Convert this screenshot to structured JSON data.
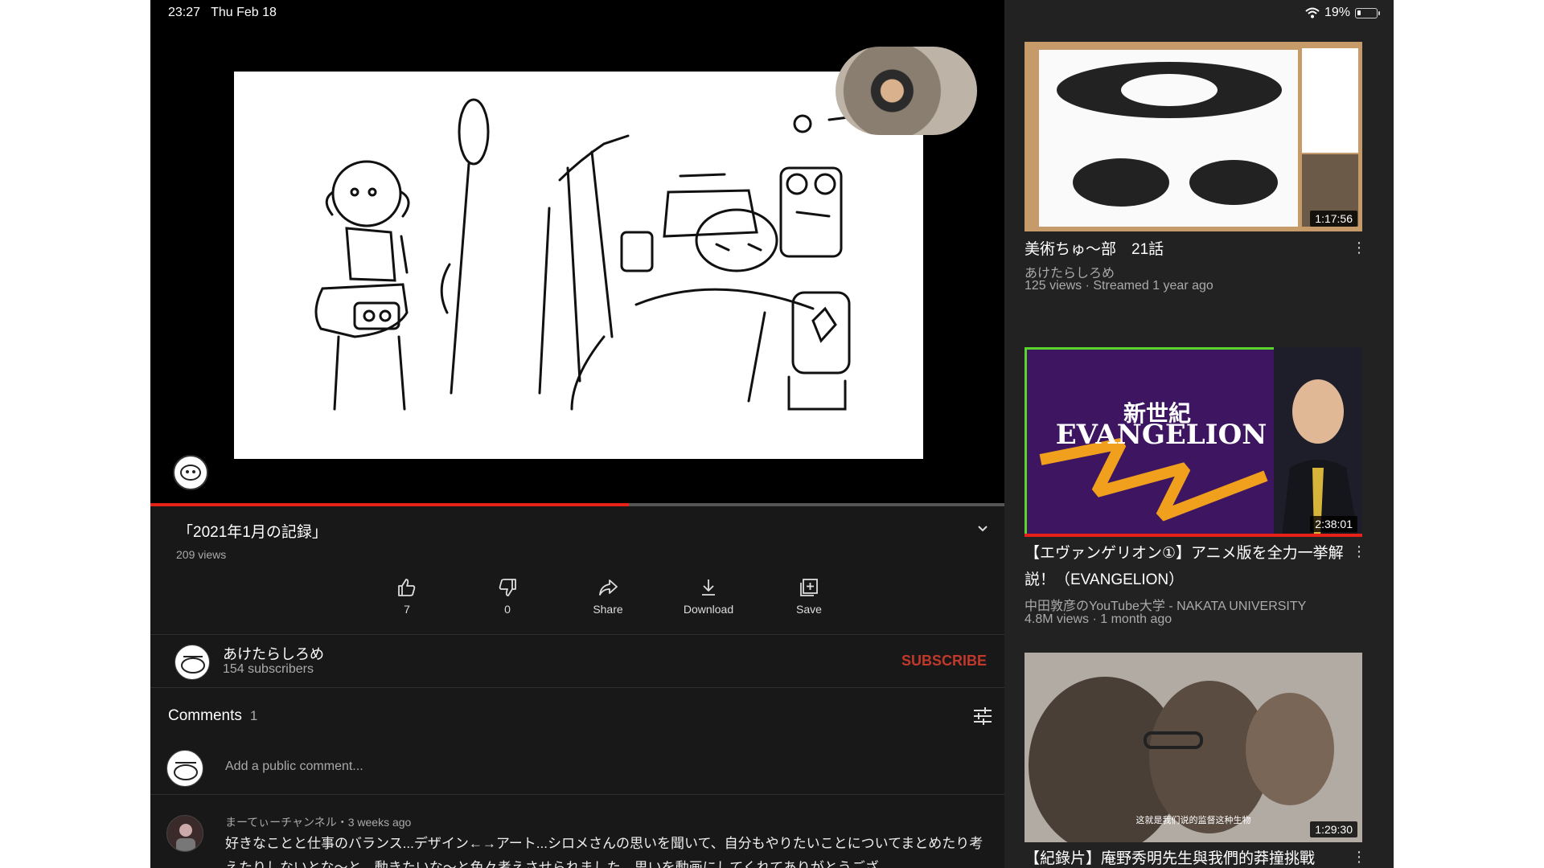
{
  "status_bar": {
    "time": "23:27",
    "date": "Thu Feb 18",
    "battery": "19%",
    "battery_level": 0.19
  },
  "video": {
    "title": "「2021年1月の記録」",
    "views": "209 views",
    "progress": 0.56
  },
  "actions": {
    "like": {
      "label": "7",
      "icon": "thumbs-up-icon"
    },
    "dislike": {
      "label": "0",
      "icon": "thumbs-down-icon"
    },
    "share": {
      "label": "Share",
      "icon": "share-icon"
    },
    "download": {
      "label": "Download",
      "icon": "download-icon"
    },
    "save": {
      "label": "Save",
      "icon": "save-playlist-icon"
    }
  },
  "channel": {
    "name": "あけたらしろめ",
    "subscribers": "154 subscribers",
    "subscribe_label": "SUBSCRIBE",
    "subscribe_color": "#c0392b"
  },
  "comments": {
    "header": "Comments",
    "count": "1",
    "placeholder": "Add a public comment...",
    "items": [
      {
        "meta": "まーてぃーチャンネル・3 weeks ago",
        "text": "好きなことと仕事のバランス...デザイン←→アート...シロメさんの思いを聞いて、自分もやりたいことについてまとめたり考えたりしないとな〜と、動きたいな〜と色々考えさせられました。思いを動画にしてくれてありがとうござ"
      }
    ]
  },
  "recommendations": [
    {
      "title": "美術ちゅ〜部　21話",
      "channel": "あけたらしろめ",
      "meta": "125 views · Streamed 1 year ago",
      "duration": "1:17:56"
    },
    {
      "title": "【エヴァンゲリオン①】アニメ版を全力一挙解説！（EVANGELION）",
      "channel": "中田敦彦のYouTube大学 - NAKATA UNIVERSITY",
      "meta": "4.8M views · 1 month ago",
      "duration": "2:38:01",
      "thumb_text": "EVANGELION",
      "thumb_text_jp": "新世紀",
      "watched": 1.0
    },
    {
      "title": "【紀錄片】庵野秀明先生與我們的莽撞挑戰",
      "duration": "1:29:30",
      "thumb_caption": "这就是我们说的监督这种生物"
    }
  ],
  "colors": {
    "accent_red": "#e62117",
    "background": "#181818",
    "sidebar": "#222222"
  }
}
